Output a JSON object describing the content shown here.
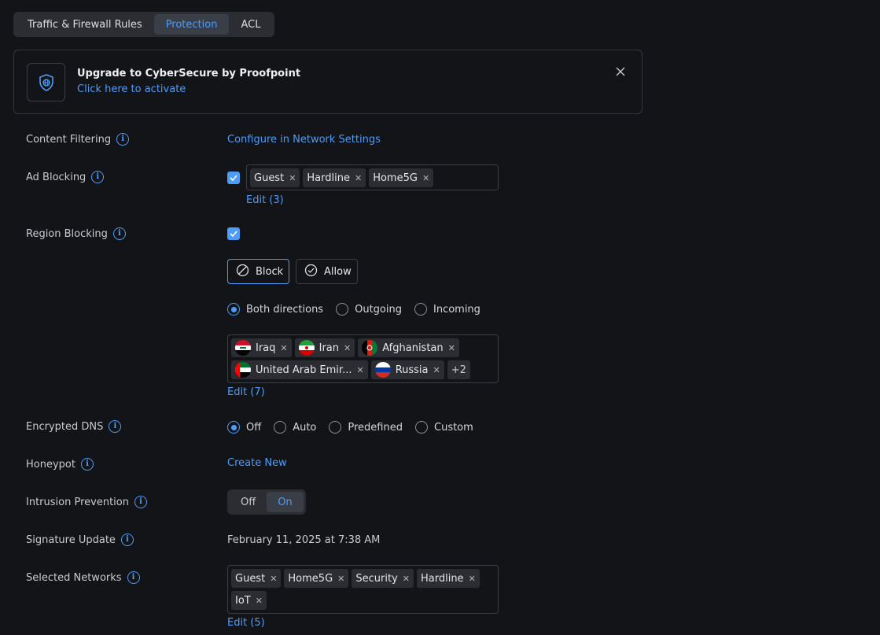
{
  "tabs": [
    "Traffic & Firewall Rules",
    "Protection",
    "ACL"
  ],
  "banner": {
    "title": "Upgrade to CyberSecure by Proofpoint",
    "link": "Click here to activate"
  },
  "content_filtering": {
    "label": "Content Filtering",
    "link": "Configure in Network Settings"
  },
  "ad_blocking": {
    "label": "Ad Blocking",
    "enabled": true,
    "networks": [
      "Guest",
      "Hardline",
      "Home5G"
    ],
    "edit": "Edit (3)"
  },
  "region_blocking": {
    "label": "Region Blocking",
    "enabled": true,
    "mode_block": "Block",
    "mode_allow": "Allow",
    "directions": [
      "Both directions",
      "Outgoing",
      "Incoming"
    ],
    "countries": [
      {
        "name": "Iraq",
        "flag": "iraq-flag-icon"
      },
      {
        "name": "Iran",
        "flag": "iran-flag-icon"
      },
      {
        "name": "Afghanistan",
        "flag": "afghanistan-flag-icon"
      },
      {
        "name": "United Arab Emir...",
        "flag": "uae-flag-icon"
      },
      {
        "name": "Russia",
        "flag": "russia-flag-icon"
      }
    ],
    "more": "+2",
    "edit": "Edit (7)"
  },
  "encrypted_dns": {
    "label": "Encrypted DNS",
    "options": [
      "Off",
      "Auto",
      "Predefined",
      "Custom"
    ]
  },
  "honeypot": {
    "label": "Honeypot",
    "link": "Create New"
  },
  "intrusion_prevention": {
    "label": "Intrusion Prevention",
    "off": "Off",
    "on": "On"
  },
  "signature_update": {
    "label": "Signature Update",
    "value": "February 11, 2025 at 7:38 AM"
  },
  "selected_networks": {
    "label": "Selected Networks",
    "networks": [
      "Guest",
      "Home5G",
      "Security",
      "Hardline",
      "IoT"
    ],
    "edit": "Edit (5)"
  },
  "colors": {
    "accent": "#4d9cf8",
    "background": "#131417",
    "surface": "#2b2d32"
  }
}
